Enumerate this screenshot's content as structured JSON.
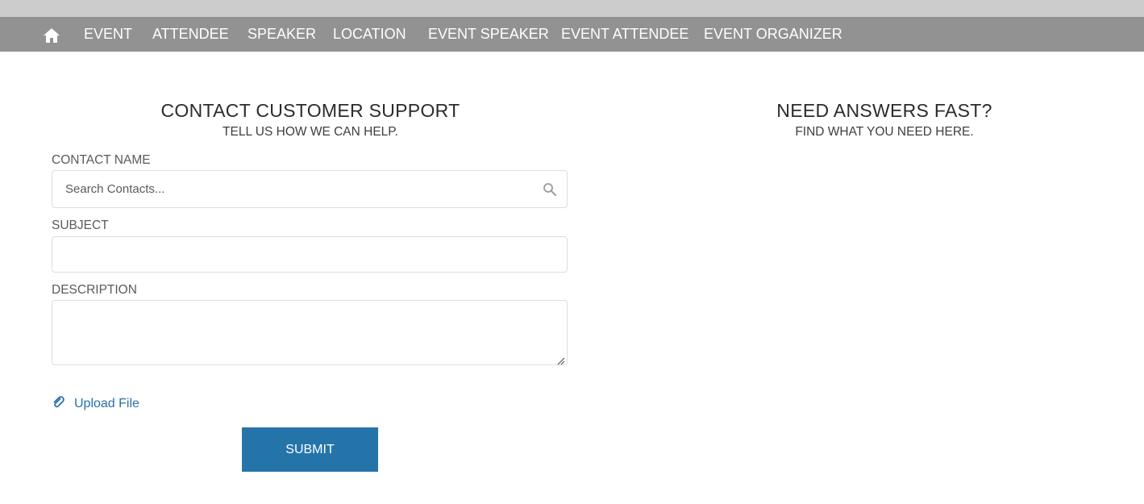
{
  "nav": {
    "home_icon": "home-icon",
    "items": [
      "EVENT",
      "ATTENDEE",
      "SPEAKER",
      "LOCATION",
      "EVENT SPEAKER",
      "EVENT ATTENDEE",
      "EVENT ORGANIZER"
    ]
  },
  "contact_form": {
    "title": "CONTACT CUSTOMER SUPPORT",
    "subtitle": "TELL US HOW WE CAN HELP.",
    "contact_name_label": "CONTACT NAME",
    "contact_name_placeholder": "Search Contacts...",
    "contact_name_value": "",
    "subject_label": "SUBJECT",
    "subject_value": "",
    "description_label": "DESCRIPTION",
    "description_value": "",
    "upload_label": "Upload File",
    "upload_icon": "paperclip-icon",
    "submit_label": "SUBMIT"
  },
  "answers": {
    "title": "NEED ANSWERS FAST?",
    "subtitle": "FIND WHAT YOU NEED HERE."
  },
  "colors": {
    "nav_background": "#929292",
    "top_strip": "#cccccc",
    "submit_button": "#2574a9",
    "link": "#2a6fa8"
  }
}
